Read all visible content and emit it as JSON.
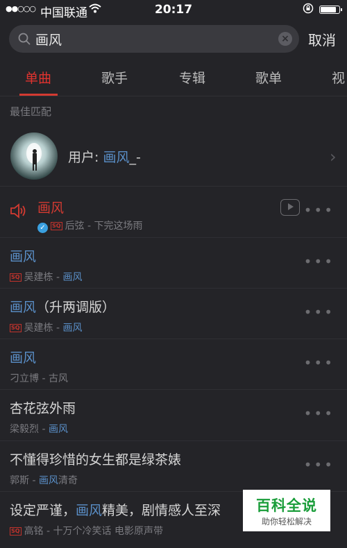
{
  "status": {
    "carrier": "中国联通",
    "time": "20:17",
    "battery_level": 0.85
  },
  "search": {
    "query": "画风",
    "placeholder": "",
    "cancel_label": "取消"
  },
  "tabs": [
    "单曲",
    "歌手",
    "专辑",
    "歌单",
    "视"
  ],
  "active_tab": 0,
  "best_match": {
    "section_title": "最佳匹配",
    "user_prefix": "用户: ",
    "user_name_hl": "画风",
    "user_name_rest": "_-"
  },
  "songs": [
    {
      "title_hl": "画风",
      "title_rest": "",
      "artist": "后弦",
      "album_hl": "",
      "album_rest": "下完这场雨",
      "playing": true,
      "verified": true,
      "sq": true,
      "mv": true
    },
    {
      "title_hl": "画风",
      "title_rest": "",
      "artist": "吴建栋",
      "album_hl": "画风",
      "album_rest": "",
      "playing": false,
      "verified": false,
      "sq": true,
      "mv": false
    },
    {
      "title_hl": "画风",
      "title_rest": "（升两调版）",
      "artist": "吴建栋",
      "album_hl": "画风",
      "album_rest": "",
      "playing": false,
      "verified": false,
      "sq": true,
      "mv": false
    },
    {
      "title_hl": "画风",
      "title_rest": "",
      "artist": "刁立博",
      "album_hl": "",
      "album_rest": "古风",
      "playing": false,
      "verified": false,
      "sq": false,
      "mv": false
    },
    {
      "title_pre": "杏花弦外雨",
      "title_hl": "",
      "title_rest": "",
      "artist": "梁毅烈",
      "album_hl": "画风",
      "album_rest": "",
      "playing": false,
      "verified": false,
      "sq": false,
      "mv": false
    },
    {
      "title_pre": "不懂得珍惜的女生都是绿茶婊",
      "title_hl": "",
      "title_rest": "",
      "artist": "郭斯",
      "album_hl": "画风",
      "album_rest": "清奇",
      "playing": false,
      "verified": false,
      "sq": false,
      "mv": false
    },
    {
      "title_pre": "设定严谨，",
      "title_hl": "画风",
      "title_rest": "精美，剧情感人至深",
      "artist": "高铭",
      "album_hl": "",
      "album_rest": "十万个冷笑话 电影原声带",
      "playing": false,
      "verified": false,
      "sq": true,
      "mv": false
    }
  ],
  "separator": " - ",
  "sq_badge": "SQ",
  "more_label": "•••",
  "watermark": {
    "title": "百科全说",
    "subtitle": "助你轻松解决"
  },
  "colors": {
    "accent": "#d33a31",
    "highlight": "#5a8fc8",
    "background": "#242428"
  }
}
